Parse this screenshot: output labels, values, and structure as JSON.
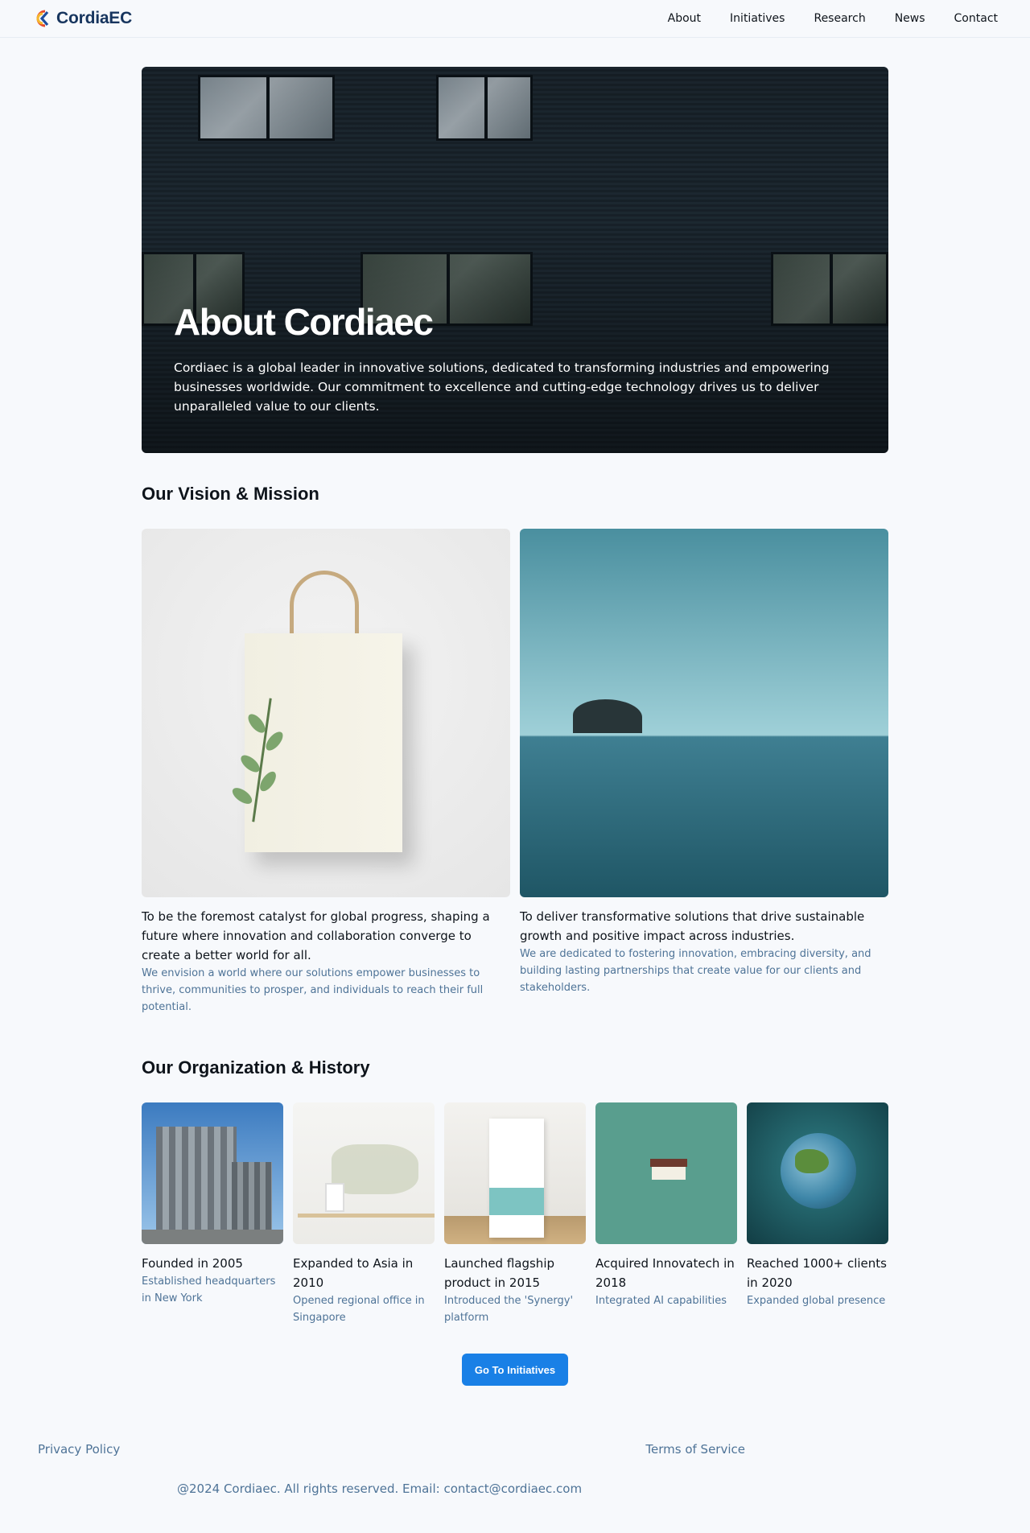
{
  "header": {
    "brand": "CordiaEC",
    "nav": [
      "About",
      "Initiatives",
      "Research",
      "News",
      "Contact"
    ]
  },
  "hero": {
    "title": "About Cordiaec",
    "text": "Cordiaec is a global leader in innovative solutions, dedicated to transforming industries and empowering businesses worldwide. Our commitment to excellence and cutting-edge technology drives us to deliver unparalleled value to our clients."
  },
  "vision_mission": {
    "title": "Our Vision & Mission",
    "items": [
      {
        "caption": "To be the foremost catalyst for global progress, shaping a future where innovation and collaboration converge to create a better world for all.",
        "description": "We envision a world where our solutions empower businesses to thrive, communities to prosper, and individuals to reach their full potential."
      },
      {
        "caption": "To deliver transformative solutions that drive sustainable growth and positive impact across industries.",
        "description": "We are dedicated to fostering innovation, embracing diversity, and building lasting partnerships that create value for our clients and stakeholders."
      }
    ]
  },
  "organization": {
    "title": "Our Organization & History",
    "items": [
      {
        "title": "Founded in 2005",
        "description": "Established headquarters in New York"
      },
      {
        "title": "Expanded to Asia in 2010",
        "description": "Opened regional office in Singapore"
      },
      {
        "title": "Launched flagship product in 2015",
        "description": "Introduced the 'Synergy' platform"
      },
      {
        "title": "Acquired Innovatech in 2018",
        "description": "Integrated AI capabilities"
      },
      {
        "title": "Reached 1000+ clients in 2020",
        "description": "Expanded global presence"
      }
    ]
  },
  "cta": {
    "label": "Go To Initiatives"
  },
  "footer": {
    "privacy": "Privacy Policy",
    "terms": "Terms of Service",
    "copyright": "@2024 Cordiaec. All rights reserved. Email: contact@cordiaec.com"
  },
  "colors": {
    "accent": "#1980e6",
    "muted_text": "#4e7397",
    "brand": "#17355e"
  }
}
